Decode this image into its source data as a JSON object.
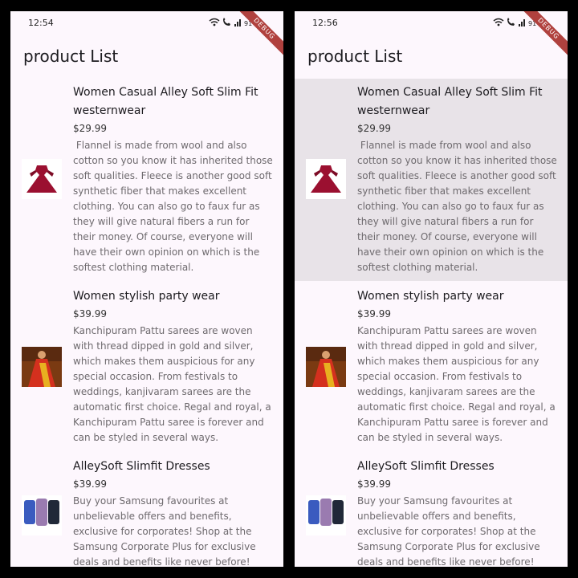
{
  "screens": [
    {
      "time": "12:54",
      "battery": "91",
      "debug_banner": "DEBUG",
      "title": "product List",
      "products": [
        {
          "title": "Women Casual Alley Soft Slim Fit westernwear",
          "price": "$29.99",
          "description": " Flannel is made from wool and also cotton so you know it has inherited those soft qualities. Fleece is another good soft synthetic fiber that makes excellent clothing. You can also go to faux fur as they will give natural fibers a run for their money. Of course, everyone will have their own opinion on which is the softest clothing material.",
          "image": "red-dress-image"
        },
        {
          "title": "Women stylish party wear",
          "price": "$39.99",
          "description": "Kanchipuram Pattu sarees are woven with thread dipped in gold and silver, which makes them auspicious for any special occasion. From festivals to weddings, kanjivaram sarees are the automatic first choice. Regal and royal, a Kanchipuram Pattu saree is forever and can be styled in several ways.",
          "image": "saree-image"
        },
        {
          "title": "AlleySoft Slimfit Dresses",
          "price": "$39.99",
          "description": "Buy your Samsung favourites at unbelievable offers and benefits, exclusive for corporates! Shop at the Samsung Corporate Plus for exclusive deals and benefits like never before!",
          "image": "phone-image"
        }
      ]
    },
    {
      "time": "12:56",
      "battery": "91",
      "debug_banner": "DEBUG",
      "title": "product List",
      "products": [
        {
          "title": "Women Casual Alley Soft Slim Fit westernwear",
          "price": "$29.99",
          "description": " Flannel is made from wool and also cotton so you know it has inherited those soft qualities. Fleece is another good soft synthetic fiber that makes excellent clothing. You can also go to faux fur as they will give natural fibers a run for their money. Of course, everyone will have their own opinion on which is the softest clothing material.",
          "image": "red-dress-image"
        },
        {
          "title": "Women stylish party wear",
          "price": "$39.99",
          "description": "Kanchipuram Pattu sarees are woven with thread dipped in gold and silver, which makes them auspicious for any special occasion. From festivals to weddings, kanjivaram sarees are the automatic first choice. Regal and royal, a Kanchipuram Pattu saree is forever and can be styled in several ways.",
          "image": "saree-image"
        },
        {
          "title": "AlleySoft Slimfit Dresses",
          "price": "$39.99",
          "description": "Buy your Samsung favourites at unbelievable offers and benefits, exclusive for corporates! Shop at the Samsung Corporate Plus for exclusive deals and benefits like never before!",
          "image": "phone-image"
        }
      ]
    }
  ],
  "colors": {
    "background": "#fdf7fd",
    "pressed_highlight": "#e8e3e8",
    "debug_banner": "#b0413e"
  }
}
